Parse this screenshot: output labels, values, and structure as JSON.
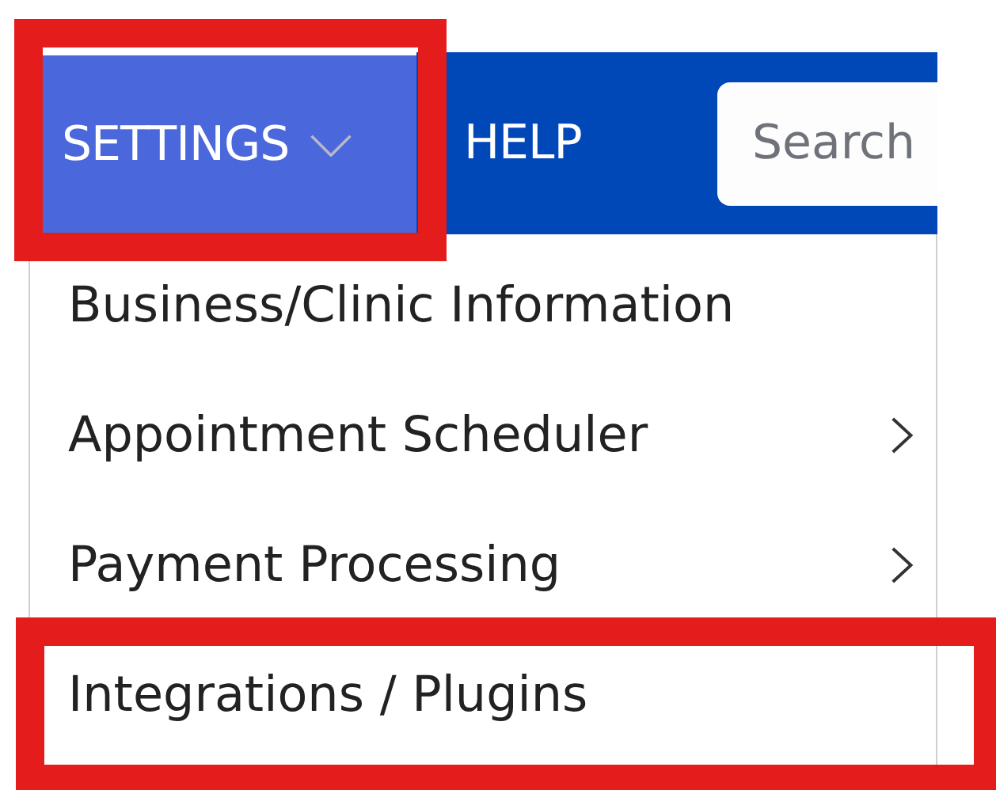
{
  "nav": {
    "tabs": [
      {
        "label": "SETTINGS",
        "selected": true,
        "highlighted": true,
        "has_caret": true
      },
      {
        "label": "HELP",
        "selected": false,
        "highlighted": false,
        "has_caret": false
      }
    ],
    "search": {
      "placeholder": "Search"
    }
  },
  "menu": {
    "items": [
      {
        "label": "Business/Clinic Information",
        "has_submenu": false,
        "highlighted": false
      },
      {
        "label": "Appointment Scheduler",
        "has_submenu": true,
        "highlighted": false
      },
      {
        "label": "Payment Processing",
        "has_submenu": true,
        "highlighted": false
      },
      {
        "label": "Integrations / Plugins",
        "has_submenu": false,
        "highlighted": true
      }
    ]
  }
}
